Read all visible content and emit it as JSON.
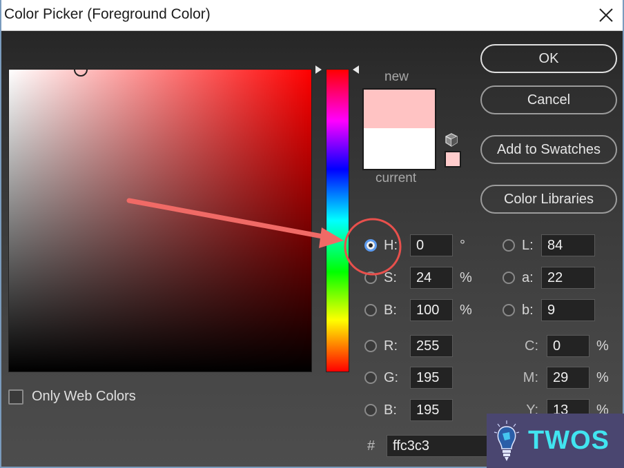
{
  "window": {
    "title": "Color Picker (Foreground Color)",
    "close_icon": "close-x-icon"
  },
  "swatch": {
    "new_label": "new",
    "current_label": "current",
    "new_color": "#ffc3c3",
    "current_color": "#ffffff",
    "web_safe_color": "#ffcccc",
    "out_of_gamut_icon": "cube-icon"
  },
  "buttons": {
    "ok": "OK",
    "cancel": "Cancel",
    "add_to_swatches": "Add to Swatches",
    "color_libraries": "Color Libraries"
  },
  "hsb": [
    {
      "label": "H:",
      "value": "0",
      "unit": "°",
      "selected": true
    },
    {
      "label": "S:",
      "value": "24",
      "unit": "%",
      "selected": false
    },
    {
      "label": "B:",
      "value": "100",
      "unit": "%",
      "selected": false
    }
  ],
  "rgb": [
    {
      "label": "R:",
      "value": "255"
    },
    {
      "label": "G:",
      "value": "195"
    },
    {
      "label": "B:",
      "value": "195"
    }
  ],
  "lab": [
    {
      "label": "L:",
      "value": "84"
    },
    {
      "label": "a:",
      "value": "22"
    },
    {
      "label": "b:",
      "value": "9"
    }
  ],
  "cmyk": [
    {
      "label": "C:",
      "value": "0",
      "unit": "%"
    },
    {
      "label": "M:",
      "value": "29",
      "unit": "%"
    },
    {
      "label": "Y:",
      "value": "13",
      "unit": "%"
    }
  ],
  "hex": {
    "symbol": "#",
    "value": "ffc3c3"
  },
  "only_web_colors": {
    "label": "Only Web Colors",
    "checked": false
  },
  "hue_slider": {
    "value_degrees": 0
  },
  "annotation": {
    "color": "#f06a66",
    "note": "arrow pointing to H radio button"
  },
  "watermark": {
    "text": "TWOS",
    "icon": "lightbulb-icon"
  }
}
